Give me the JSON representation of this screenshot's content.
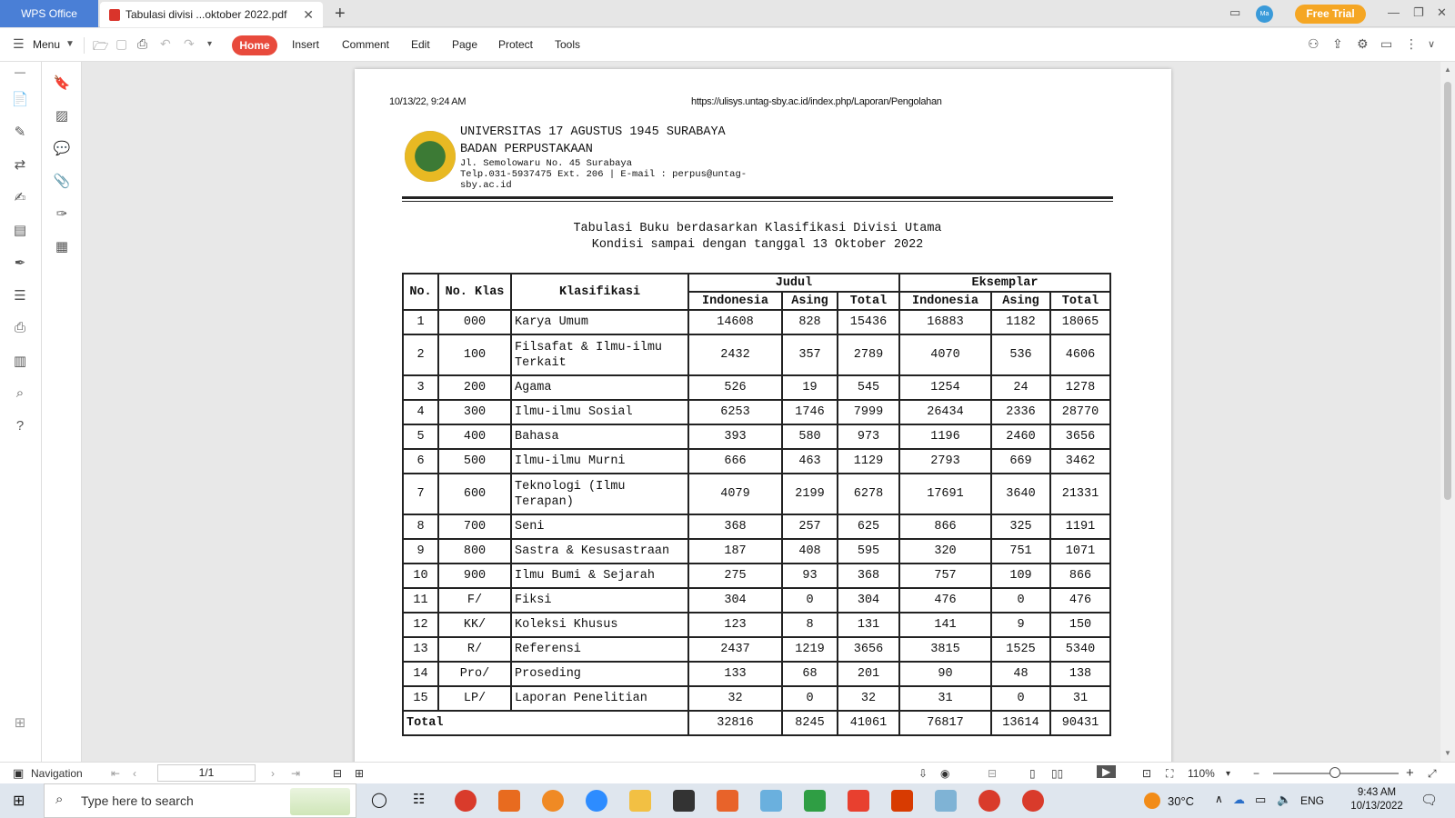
{
  "titlebar": {
    "app_tab": "WPS Office",
    "doc_tab": "Tabulasi divisi ...oktober 2022.pdf",
    "free_trial": "Free Trial",
    "avatar": "Ma"
  },
  "ribbon": {
    "menu": "Menu",
    "tabs": [
      "Home",
      "Insert",
      "Comment",
      "Edit",
      "Page",
      "Protect",
      "Tools"
    ]
  },
  "document": {
    "print_date": "10/13/22, 9:24 AM",
    "print_url": "https://ulisys.untag-sby.ac.id/index.php/Laporan/Pengolahan",
    "institution": "UNIVERSITAS 17 AGUSTUS 1945 SURABAYA",
    "department": "BADAN PERPUSTAKAAN",
    "address": "Jl. Semolowaru No. 45 Surabaya",
    "contact": "Telp.031-5937475 Ext. 206 | E-mail : perpus@untag-sby.ac.id",
    "title": "Tabulasi Buku berdasarkan Klasifikasi Divisi Utama",
    "subtitle": "Kondisi sampai dengan tanggal 13 Oktober 2022",
    "table": {
      "headers": {
        "no": "No.",
        "no_klas": "No. Klas",
        "klasifikasi": "Klasifikasi",
        "judul": "Judul",
        "eksemplar": "Eksemplar",
        "indonesia": "Indonesia",
        "asing": "Asing",
        "total": "Total"
      },
      "rows": [
        [
          "1",
          "000",
          "Karya Umum",
          "14608",
          "828",
          "15436",
          "16883",
          "1182",
          "18065"
        ],
        [
          "2",
          "100",
          "Filsafat & Ilmu-ilmu Terkait",
          "2432",
          "357",
          "2789",
          "4070",
          "536",
          "4606"
        ],
        [
          "3",
          "200",
          "Agama",
          "526",
          "19",
          "545",
          "1254",
          "24",
          "1278"
        ],
        [
          "4",
          "300",
          "Ilmu-ilmu Sosial",
          "6253",
          "1746",
          "7999",
          "26434",
          "2336",
          "28770"
        ],
        [
          "5",
          "400",
          "Bahasa",
          "393",
          "580",
          "973",
          "1196",
          "2460",
          "3656"
        ],
        [
          "6",
          "500",
          "Ilmu-ilmu Murni",
          "666",
          "463",
          "1129",
          "2793",
          "669",
          "3462"
        ],
        [
          "7",
          "600",
          "Teknologi (Ilmu Terapan)",
          "4079",
          "2199",
          "6278",
          "17691",
          "3640",
          "21331"
        ],
        [
          "8",
          "700",
          "Seni",
          "368",
          "257",
          "625",
          "866",
          "325",
          "1191"
        ],
        [
          "9",
          "800",
          "Sastra & Kesusastraan",
          "187",
          "408",
          "595",
          "320",
          "751",
          "1071"
        ],
        [
          "10",
          "900",
          "Ilmu Bumi & Sejarah",
          "275",
          "93",
          "368",
          "757",
          "109",
          "866"
        ],
        [
          "11",
          "F/",
          "Fiksi",
          "304",
          "0",
          "304",
          "476",
          "0",
          "476"
        ],
        [
          "12",
          "KK/",
          "Koleksi Khusus",
          "123",
          "8",
          "131",
          "141",
          "9",
          "150"
        ],
        [
          "13",
          "R/",
          "Referensi",
          "2437",
          "1219",
          "3656",
          "3815",
          "1525",
          "5340"
        ],
        [
          "14",
          "Pro/",
          "Proseding",
          "133",
          "68",
          "201",
          "90",
          "48",
          "138"
        ],
        [
          "15",
          "LP/",
          "Laporan Penelitian",
          "32",
          "0",
          "32",
          "31",
          "0",
          "31"
        ]
      ],
      "total_label": "Total",
      "totals": [
        "32816",
        "8245",
        "41061",
        "76817",
        "13614",
        "90431"
      ]
    }
  },
  "statusbar": {
    "navigation": "Navigation",
    "page": "1/1",
    "zoom": "110%"
  },
  "taskbar": {
    "search_placeholder": "Type here to search",
    "weather": "30°C",
    "language": "ENG",
    "time": "9:43 AM",
    "date": "10/13/2022"
  }
}
